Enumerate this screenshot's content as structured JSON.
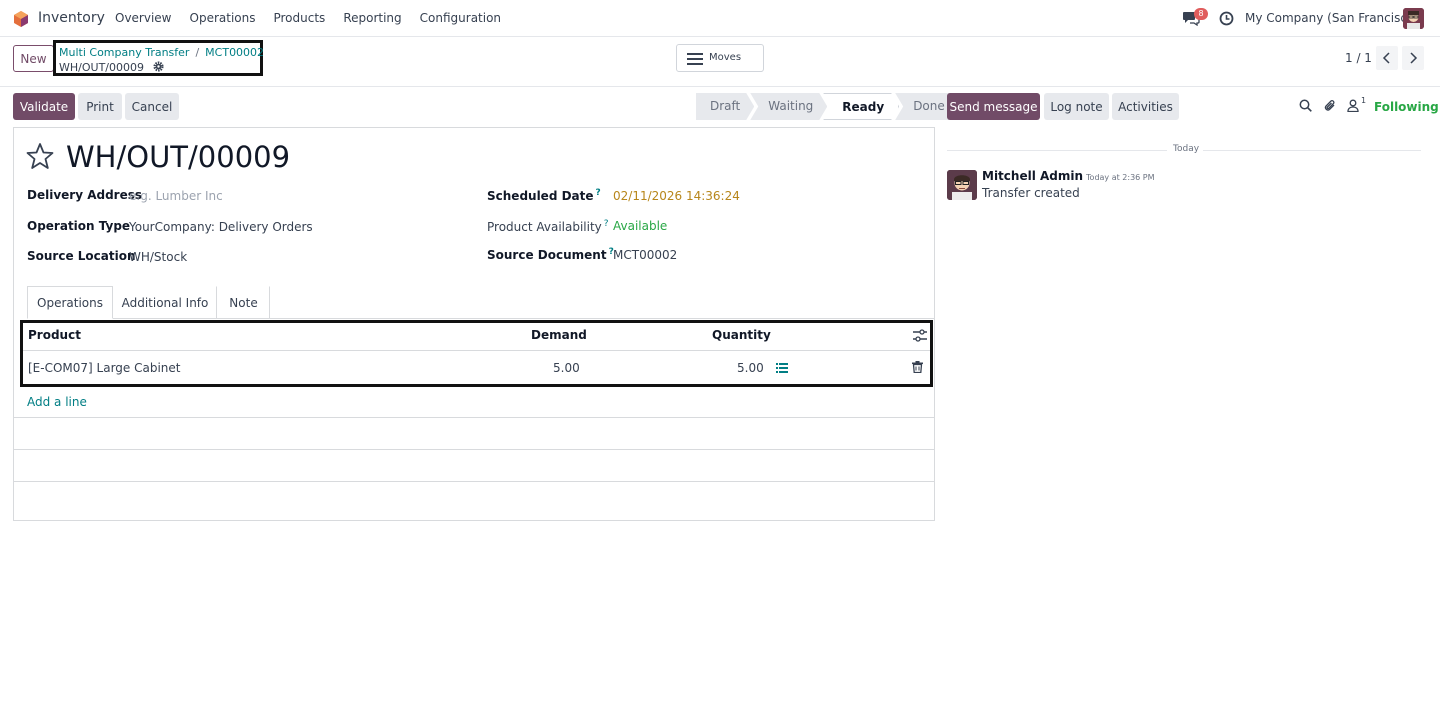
{
  "navbar": {
    "app_name": "Inventory",
    "menu": [
      "Overview",
      "Operations",
      "Products",
      "Reporting",
      "Configuration"
    ],
    "chat_badge": "8",
    "company": "My Company (San Francisco)"
  },
  "control": {
    "new_label": "New",
    "breadcrumb_parent": "Multi Company Transfer",
    "breadcrumb_sep": "/",
    "breadcrumb_child": "MCT00002",
    "current_record": "WH/OUT/00009",
    "moves_label": "Moves",
    "pager": "1 / 1"
  },
  "actions": {
    "validate": "Validate",
    "print": "Print",
    "cancel": "Cancel"
  },
  "stages": [
    "Draft",
    "Waiting",
    "Ready",
    "Done"
  ],
  "active_stage": "Ready",
  "form": {
    "title": "WH/OUT/00009",
    "delivery_address_label": "Delivery Address",
    "delivery_address_placeholder": "e.g. Lumber Inc",
    "operation_type_label": "Operation Type",
    "operation_type_value": "YourCompany: Delivery Orders",
    "source_location_label": "Source Location",
    "source_location_value": "WH/Stock",
    "scheduled_date_label": "Scheduled Date",
    "scheduled_date_value": "02/11/2026 14:36:24",
    "product_availability_label": "Product Availability",
    "product_availability_value": "Available",
    "source_document_label": "Source Document",
    "source_document_value": "MCT00002",
    "help_mark": "?"
  },
  "tabs": [
    "Operations",
    "Additional Info",
    "Note"
  ],
  "lines": {
    "headers": {
      "product": "Product",
      "demand": "Demand",
      "quantity": "Quantity"
    },
    "rows": [
      {
        "product": "[E-COM07] Large Cabinet",
        "demand": "5.00",
        "quantity": "5.00"
      }
    ],
    "add_line": "Add a line"
  },
  "chatter": {
    "send_message": "Send message",
    "log_note": "Log note",
    "activities": "Activities",
    "followers_count": "1",
    "following": "Following",
    "date_separator": "Today",
    "message": {
      "author": "Mitchell Admin",
      "time": "Today at 2:36 PM",
      "body": "Transfer created"
    }
  },
  "colors": {
    "brand": "#714b67",
    "link": "#017e84",
    "success": "#28a745",
    "warning": "#b7861b"
  }
}
